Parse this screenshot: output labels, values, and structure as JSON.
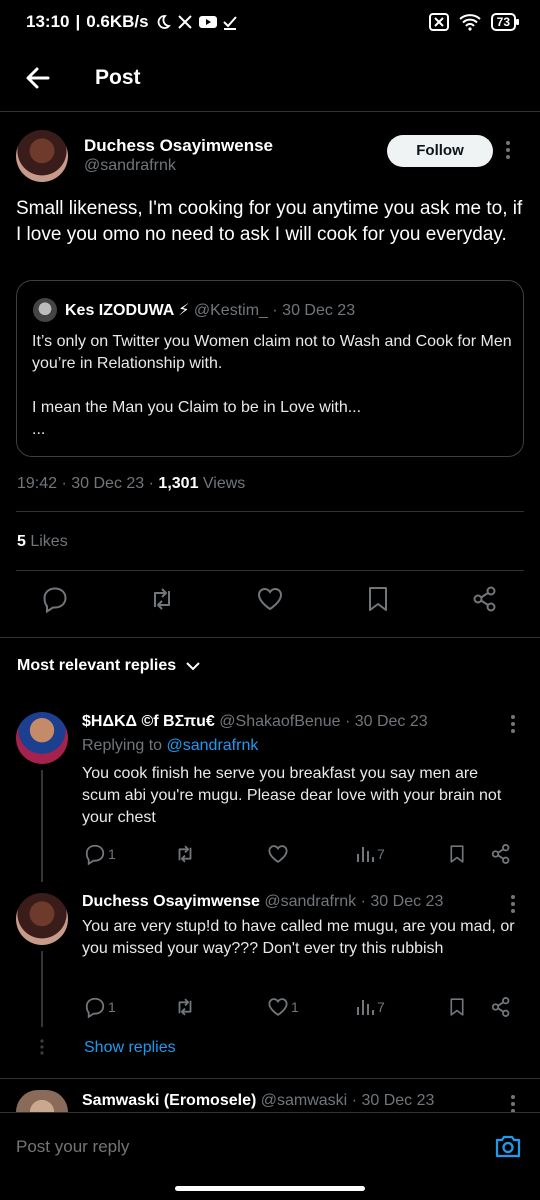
{
  "status_bar": {
    "time": "13:10",
    "speed": "0.6KB/s",
    "battery": "73",
    "icons": [
      "moon-icon",
      "x-logo-icon",
      "youtube-icon",
      "download-check-icon",
      "sim-off-icon",
      "wifi-icon",
      "battery-icon"
    ]
  },
  "header": {
    "title": "Post",
    "back_icon": "arrow-left-icon"
  },
  "tweet": {
    "author_name": "Duchess Osayimwense",
    "author_handle": "@sandrafrnk",
    "follow_label": "Follow",
    "text": "Small likeness, I'm cooking for you anytime you ask me to, if I love you omo no need to ask I will cook for you everyday.",
    "quote": {
      "author_name": "Kes IZODUWA ⚡",
      "author_handle": "@Kestim_",
      "date": "· 30 Dec 23",
      "text": "It’s only on Twitter you Women claim not to Wash and Cook for Men you’re in Relationship with.\n\nI mean the Man you Claim to be in Love with...\n..."
    },
    "time": "19:42 · 30 Dec 23 · ",
    "views_count": "1,301",
    "views_label": " Views",
    "likes_count": "5",
    "likes_label": " Likes"
  },
  "replies_section": {
    "title": "Most relevant replies"
  },
  "replies": [
    {
      "name": "$HΔKΔ ©f BΣπu€",
      "handle": "@ShakaofBenue",
      "date": "· 30 Dec 23",
      "replying_prefix": "Replying to ",
      "replying_to": "@sandrafrnk",
      "text": "You cook finish he serve you breakfast you say men are scum abi you're mugu. Please dear love with your brain not your chest",
      "reply_count": "1",
      "like_count": "",
      "view_count": "7"
    },
    {
      "name": "Duchess Osayimwense",
      "handle": "@sandrafrnk",
      "date": "· 30 Dec 23",
      "text": "You are very stup!d to have called me mugu, are you mad, or you missed your way??? Don't ever try this rubbish",
      "reply_count": "1",
      "like_count": "1",
      "view_count": "7"
    },
    {
      "name": "Samwaski (Eromosele)",
      "handle": "@samwaski",
      "date": "· 30 Dec 23"
    }
  ],
  "show_replies_label": "Show replies",
  "composer": {
    "placeholder": "Post your reply"
  },
  "colors": {
    "background": "#000000",
    "accent": "#1d9bf0",
    "muted": "#71767b",
    "divider": "#2f3336"
  }
}
